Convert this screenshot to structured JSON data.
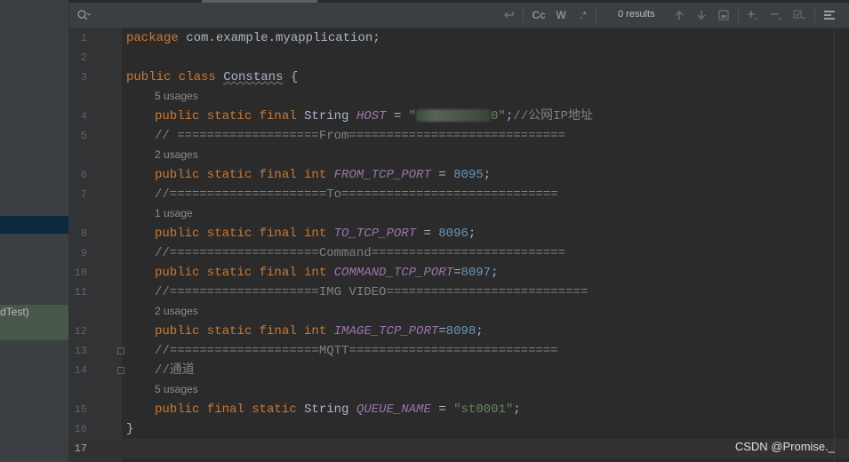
{
  "search": {
    "results": "0 results",
    "icons": [
      "search-icon",
      "regex-replace-icon",
      "match-case-icon",
      "words-icon",
      "regex-icon",
      "prev-occurrence-icon",
      "next-occurrence-icon",
      "select-all-icon",
      "add-selection-icon",
      "remove-selection-icon",
      "filter-icon",
      "menu-icon"
    ],
    "cc_label": "Cc",
    "w_label": "W"
  },
  "left_panel": {
    "run_item": "dTest)"
  },
  "editor": {
    "lines": [
      {
        "num": "1",
        "tokens": [
          [
            "kw",
            "package "
          ],
          [
            "plain",
            "com.example.myapplication;"
          ]
        ]
      },
      {
        "num": "2",
        "tokens": []
      },
      {
        "num": "3",
        "tokens": [
          [
            "kw",
            "public class "
          ],
          [
            "cls",
            "Constans"
          ],
          [
            "plain",
            " {"
          ]
        ]
      },
      {
        "num": "4",
        "hint": "5 usages",
        "tokens": [
          [
            "kw",
            "public static final "
          ],
          [
            "plain",
            "String "
          ],
          [
            "const",
            "HOST"
          ],
          [
            "plain",
            " = "
          ],
          [
            "str",
            "\""
          ],
          [
            "blur",
            ""
          ],
          [
            "str",
            "0\""
          ],
          [
            "plain",
            ";"
          ],
          [
            "cmt",
            "//公网IP地址"
          ]
        ]
      },
      {
        "num": "5",
        "tokens": [
          [
            "cmt",
            "// ===================From============================="
          ]
        ]
      },
      {
        "num": "6",
        "hint": "2 usages",
        "tokens": [
          [
            "kw",
            "public static final int "
          ],
          [
            "const",
            "FROM_TCP_PORT"
          ],
          [
            "plain",
            " = "
          ],
          [
            "num",
            "8095"
          ],
          [
            "plain",
            ";"
          ]
        ]
      },
      {
        "num": "7",
        "tokens": [
          [
            "cmt",
            "//=====================To============================="
          ]
        ]
      },
      {
        "num": "8",
        "hint": "1 usage",
        "tokens": [
          [
            "kw",
            "public static final int "
          ],
          [
            "const",
            "TO_TCP_PORT"
          ],
          [
            "plain",
            " = "
          ],
          [
            "num",
            "8096"
          ],
          [
            "plain",
            ";"
          ]
        ]
      },
      {
        "num": "9",
        "tokens": [
          [
            "cmt",
            "//====================Command=========================="
          ]
        ]
      },
      {
        "num": "10",
        "tokens": [
          [
            "kw",
            "public static final int "
          ],
          [
            "const",
            "COMMAND_TCP_PORT"
          ],
          [
            "plain",
            "="
          ],
          [
            "num",
            "8097"
          ],
          [
            "plain",
            ";"
          ]
        ]
      },
      {
        "num": "11",
        "tokens": [
          [
            "cmt",
            "//====================IMG VIDEO==========================="
          ]
        ]
      },
      {
        "num": "12",
        "hint": "2 usages",
        "tokens": [
          [
            "kw",
            "public static final int "
          ],
          [
            "const",
            "IMAGE_TCP_PORT"
          ],
          [
            "plain",
            "="
          ],
          [
            "num",
            "8098"
          ],
          [
            "plain",
            ";"
          ]
        ]
      },
      {
        "num": "13",
        "tokens": [
          [
            "cmt",
            "//====================MQTT============================"
          ]
        ]
      },
      {
        "num": "14",
        "tokens": [
          [
            "cmt",
            "//通道"
          ]
        ]
      },
      {
        "num": "15",
        "hint": "5 usages",
        "tokens": [
          [
            "kw",
            "public final static "
          ],
          [
            "plain",
            "String "
          ],
          [
            "const",
            "QUEUE_NAME"
          ],
          [
            "plain",
            " = "
          ],
          [
            "str",
            "\"st0001\""
          ],
          [
            "plain",
            ";"
          ]
        ]
      },
      {
        "num": "16",
        "tokens": [
          [
            "plain",
            "}"
          ]
        ]
      },
      {
        "num": "17",
        "tokens": []
      }
    ]
  },
  "watermark": "CSDN @Promise._"
}
